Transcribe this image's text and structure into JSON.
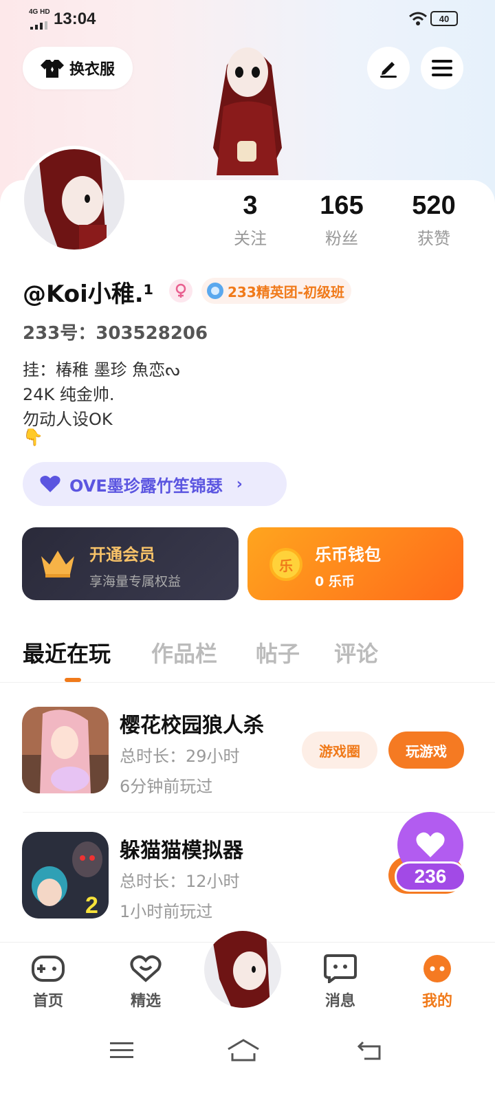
{
  "status_bar": {
    "time": "13:04",
    "network": "4G HD",
    "battery": "40"
  },
  "header": {
    "outfit_label": "换衣服",
    "edit_icon": "pen-icon",
    "menu_icon": "hamburger-icon"
  },
  "stats": [
    {
      "value": "3",
      "label": "关注"
    },
    {
      "value": "165",
      "label": "粉丝"
    },
    {
      "value": "520",
      "label": "获赞"
    }
  ],
  "profile": {
    "username": "@Koi小稚.¹",
    "group_badge": "233精英团-初级班",
    "user_id": "233号：303528206",
    "bio_lines": [
      "挂：椿稚 墨珍 魚恋ᔓ",
      "24K 纯金帅.",
      "勿动人设OK",
      "👇"
    ],
    "fan_pill": "OVE墨珍露竹笙锦瑟"
  },
  "cards": {
    "vip_title": "开通会员",
    "vip_sub": "享海量专属权益",
    "wallet_title": "乐币钱包",
    "wallet_sub": "0 乐币",
    "coin_char": "乐"
  },
  "tabs": [
    "最近在玩",
    "作品栏",
    "帖子",
    "评论"
  ],
  "games": [
    {
      "title": "樱花校园狼人杀",
      "duration": "总时长：29小时",
      "last_played": "6分钟前玩过",
      "circle_btn": "游戏圈",
      "play_btn": "玩游戏"
    },
    {
      "title": "躲猫猫模拟器",
      "duration": "总时长：12小时",
      "last_played": "1小时前玩过",
      "play_btn": "玩游戏"
    }
  ],
  "like": {
    "count": "236"
  },
  "bottom_nav": [
    {
      "label": "首页",
      "icon": "gamepad-icon"
    },
    {
      "label": "精选",
      "icon": "heart-chat-icon"
    },
    {
      "label": "",
      "icon": "avatar-icon"
    },
    {
      "label": "消息",
      "icon": "message-icon"
    },
    {
      "label": "我的",
      "icon": "profile-icon"
    }
  ],
  "colors": {
    "accent": "#f07a1a",
    "purple": "#5b55e0",
    "like": "#b25cf0"
  }
}
